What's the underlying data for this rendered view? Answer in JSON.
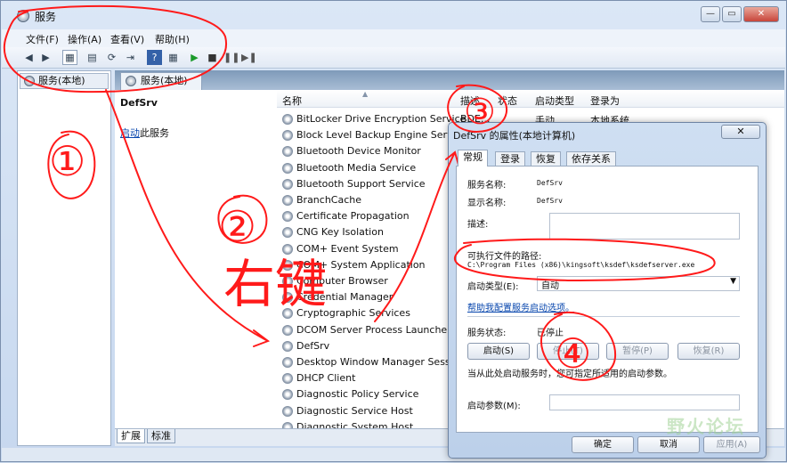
{
  "window": {
    "title": "服务",
    "min": "—",
    "max": "▭",
    "close": "✕"
  },
  "menu": [
    "文件(F)",
    "操作(A)",
    "查看(V)",
    "帮助(H)"
  ],
  "toolbar": [
    "◀",
    "▶",
    "▦",
    "▤",
    "⟳",
    "⇥",
    "?",
    "▦",
    "▶",
    "■",
    "❚❚",
    "▶❚"
  ],
  "tree": {
    "root": "服务(本地)"
  },
  "main": {
    "tab": "服务(本地)",
    "selected_name": "DefSrv",
    "start_link": "启动",
    "start_rest": "此服务"
  },
  "columns": [
    "名称",
    "描述",
    "状态",
    "启动类型",
    "登录为"
  ],
  "services": [
    {
      "name": "BitLocker Drive Encryption Service",
      "desc": "BDE...",
      "status": "",
      "startup": "手动",
      "logon": "本地系统"
    },
    {
      "name": "Block Level Backup Engine Service",
      "desc": "",
      "status": "",
      "startup": "",
      "logon": ""
    },
    {
      "name": "Bluetooth Device Monitor",
      "desc": "",
      "status": "",
      "startup": "",
      "logon": ""
    },
    {
      "name": "Bluetooth Media Service",
      "desc": "",
      "status": "",
      "startup": "",
      "logon": ""
    },
    {
      "name": "Bluetooth Support Service",
      "desc": "",
      "status": "",
      "startup": "",
      "logon": ""
    },
    {
      "name": "BranchCache",
      "desc": "",
      "status": "",
      "startup": "",
      "logon": ""
    },
    {
      "name": "Certificate Propagation",
      "desc": "",
      "status": "",
      "startup": "",
      "logon": ""
    },
    {
      "name": "CNG Key Isolation",
      "desc": "",
      "status": "",
      "startup": "",
      "logon": ""
    },
    {
      "name": "COM+ Event System",
      "desc": "",
      "status": "",
      "startup": "",
      "logon": ""
    },
    {
      "name": "COM+ System Application",
      "desc": "",
      "status": "",
      "startup": "",
      "logon": ""
    },
    {
      "name": "Computer Browser",
      "desc": "",
      "status": "",
      "startup": "",
      "logon": ""
    },
    {
      "name": "Credential Manager",
      "desc": "",
      "status": "",
      "startup": "",
      "logon": ""
    },
    {
      "name": "Cryptographic Services",
      "desc": "",
      "status": "",
      "startup": "",
      "logon": ""
    },
    {
      "name": "DCOM Server Process Launcher",
      "desc": "",
      "status": "",
      "startup": "",
      "logon": ""
    },
    {
      "name": "DefSrv",
      "desc": "",
      "status": "",
      "startup": "",
      "logon": ""
    },
    {
      "name": "Desktop Window Manager Session",
      "desc": "",
      "status": "",
      "startup": "",
      "logon": ""
    },
    {
      "name": "DHCP Client",
      "desc": "",
      "status": "",
      "startup": "",
      "logon": ""
    },
    {
      "name": "Diagnostic Policy Service",
      "desc": "",
      "status": "",
      "startup": "",
      "logon": ""
    },
    {
      "name": "Diagnostic Service Host",
      "desc": "",
      "status": "",
      "startup": "",
      "logon": ""
    },
    {
      "name": "Diagnostic System Host",
      "desc": "",
      "status": "",
      "startup": "",
      "logon": ""
    }
  ],
  "bottom_tabs": [
    "扩展",
    "标准"
  ],
  "dialog": {
    "title": "DefSrv 的属性(本地计算机)",
    "close": "✕",
    "tabs": [
      "常规",
      "登录",
      "恢复",
      "依存关系"
    ],
    "service_name_label": "服务名称:",
    "service_name": "DefSrv",
    "display_name_label": "显示名称:",
    "display_name": "DefSrv",
    "description_label": "描述:",
    "exe_path_label": "可执行文件的路径:",
    "exe_path": "C:\\Program Files (x86)\\kingsoft\\ksdef\\ksdefserver.exe",
    "startup_type_label": "启动类型(E):",
    "startup_type": "自动",
    "help_link": "帮助我配置服务启动选项。",
    "status_label": "服务状态:",
    "status": "已停止",
    "btn_start": "启动(S)",
    "btn_stop": "停止(T)",
    "btn_pause": "暂停(P)",
    "btn_resume": "恢复(R)",
    "hint": "当从此处启动服务时，您可指定所适用的启动参数。",
    "param_label": "启动参数(M):",
    "ok": "确定",
    "cancel": "取消",
    "apply": "应用(A)"
  },
  "annotations": {
    "n1": "①",
    "n2": "②",
    "n3": "③",
    "n4": "④",
    "note": "右键"
  },
  "watermark": "野火论坛",
  "colors": {
    "annotation": "#ff1a1a",
    "link": "#0645ad",
    "titlebar": "#c7d8ef"
  }
}
